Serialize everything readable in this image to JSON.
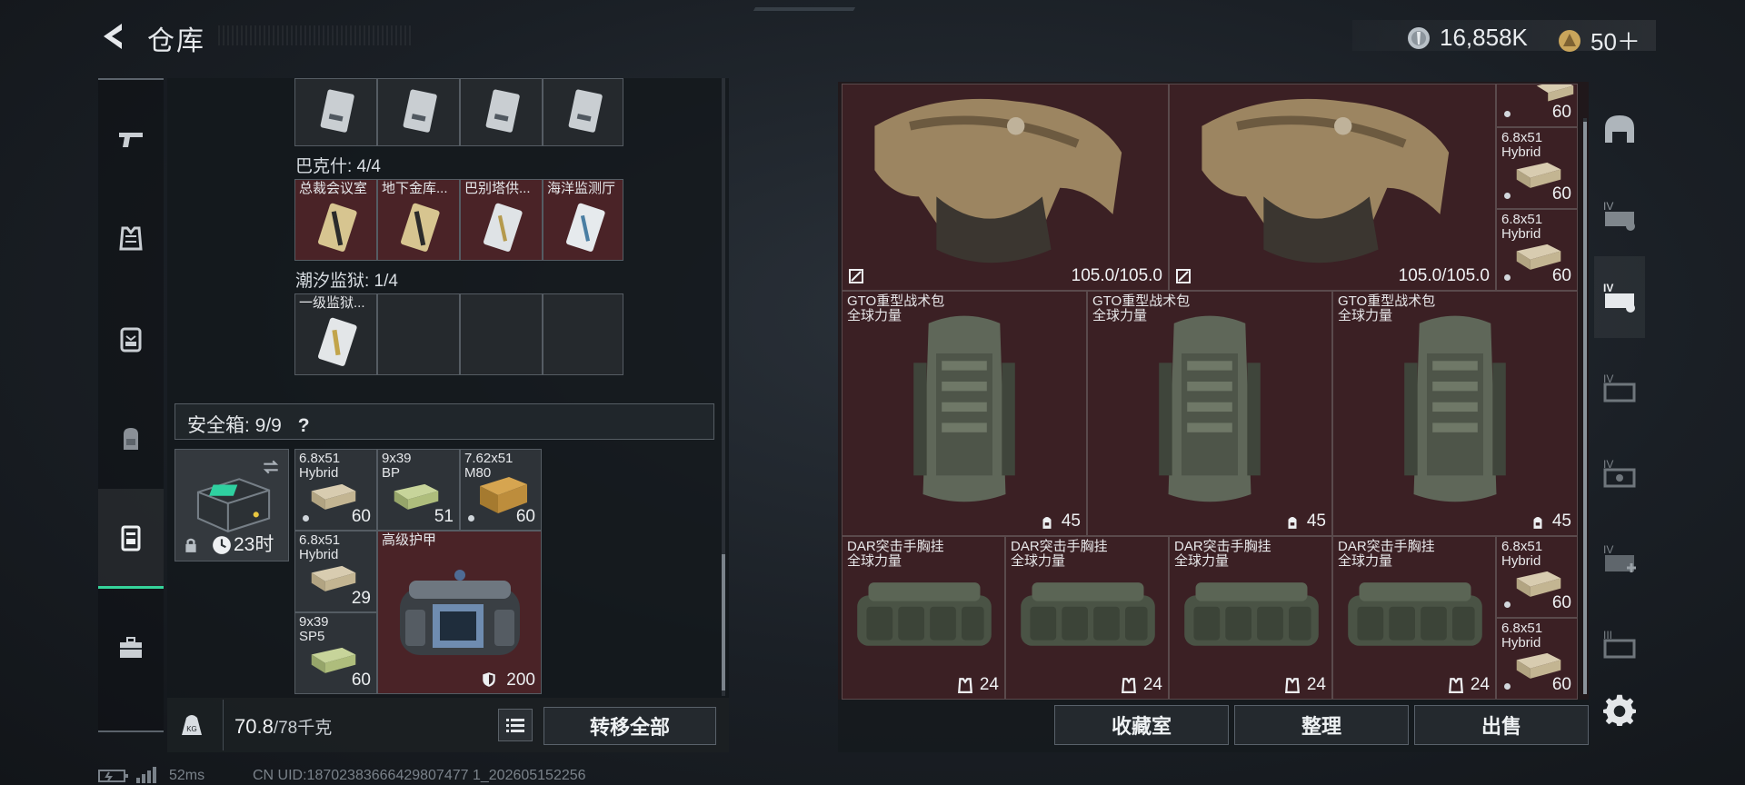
{
  "header": {
    "title": "仓库",
    "currency_silver": "16,858K",
    "currency_gold": "50＋"
  },
  "left_nav": [
    "pistol-icon",
    "armor-icon",
    "rig-icon",
    "backpack-icon",
    "safebox-icon",
    "toolbox-icon"
  ],
  "keycards": {
    "row1_labels": [
      "",
      "",
      "",
      ""
    ],
    "group_bakshi_label": "巴克什: 4/4",
    "row2_labels": [
      "总裁会议室",
      "地下金库...",
      "巴别塔供...",
      "海洋监测厅"
    ],
    "group_tide_label": "潮汐监狱: 1/4",
    "row3_labels": [
      "一级监狱..."
    ]
  },
  "safe_box": {
    "label": "安全箱:  9/9",
    "help": "?",
    "timer": "23时",
    "items": [
      {
        "label": "6.8x51\nHybrid",
        "count": "60"
      },
      {
        "label": "9x39\nBP",
        "count": "51"
      },
      {
        "label": "7.62x51\nM80",
        "count": "60"
      },
      {
        "label": "6.8x51\nHybrid",
        "count": "29"
      },
      {
        "label": "高级护甲",
        "count": "200"
      },
      {
        "label": "9x39\nSP5",
        "count": "60"
      }
    ]
  },
  "footer_left": {
    "weight_current": "70.8",
    "weight_max": "/78千克",
    "transfer_all": "转移全部"
  },
  "storage": {
    "armor_durability": [
      "105.0/105.0",
      "105.0/105.0"
    ],
    "backpack_label": "GTO重型战术包\n全球力量",
    "backpack_count": "45",
    "rig_label": "DAR突击手胸挂\n全球力量",
    "rig_count": "24",
    "ammo_side": [
      {
        "label": "",
        "count": "60"
      },
      {
        "label": "6.8x51\nHybrid",
        "count": "60"
      },
      {
        "label": "6.8x51\nHybrid",
        "count": "60"
      },
      {
        "label": "6.8x51\nHybrid",
        "count": "60"
      },
      {
        "label": "6.8x51\nHybrid",
        "count": "60"
      }
    ]
  },
  "footer_right": {
    "collection": "收藏室",
    "organize": "整理",
    "sell": "出售"
  },
  "status": {
    "ping": "52ms",
    "uid": "CN UID:18702383666429807477 1_202605152256"
  },
  "right_nav": [
    "dome-icon",
    "tier-iv-icon",
    "tier-iv-icon",
    "tier-iv-icon",
    "tier-iv-icon",
    "tier-iv-icon",
    "tier-iii-icon",
    "gear-icon"
  ]
}
